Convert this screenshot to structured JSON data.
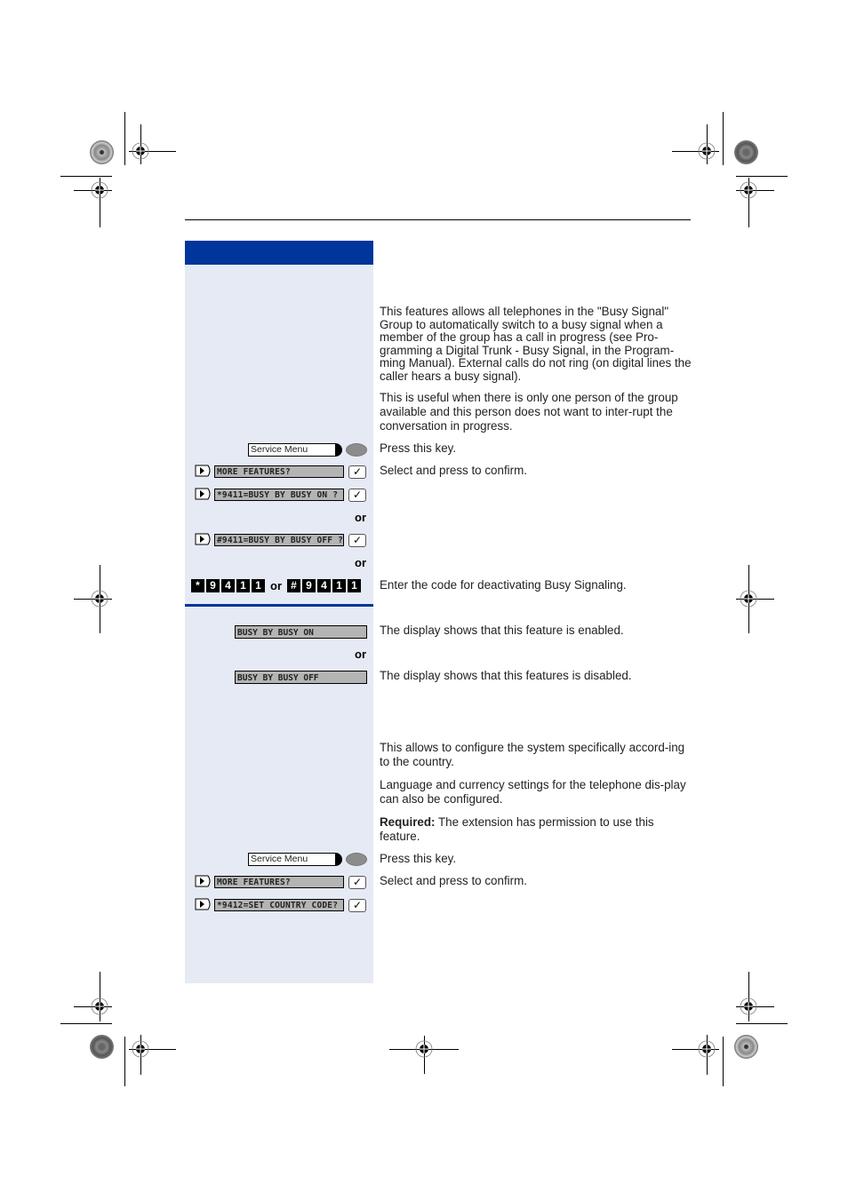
{
  "section1": {
    "intro_paragraphs": [
      "This features allows all telephones in the \"Busy Signal\" Group to automatically switch to a busy signal when a member of the group has a call in progress (see Pro-gramming a Digital Trunk - Busy Signal, in the Program-ming Manual). External calls do not ring (on digital lines the caller hears a busy signal).",
      "This is useful when there is only one person of the group available and this person does not want to inter-rupt the conversation in progress."
    ],
    "service_key_label": "Service Menu",
    "steps": [
      {
        "display": "MORE FEATURES?",
        "description": "Select and press to confirm."
      },
      {
        "display": "*9411=BUSY BY BUSY ON ?"
      },
      {
        "display": "#9411=BUSY BY BUSY OFF ?"
      }
    ],
    "press_key_text": "Press this key.",
    "or_label": "or",
    "code_on": [
      "*",
      "9",
      "4",
      "1",
      "1"
    ],
    "code_off": [
      "#",
      "9",
      "4",
      "1",
      "1"
    ],
    "code_text": "Enter the code for deactivating Busy Signaling.",
    "results": [
      {
        "display": "BUSY BY BUSY ON",
        "description": "The display shows that this feature is enabled."
      },
      {
        "display": "BUSY BY BUSY OFF",
        "description": "The display shows that this features is disabled."
      }
    ]
  },
  "section2": {
    "paragraphs": [
      "This allows to configure the system specifically accord-ing to the country.",
      "Language and currency settings for the telephone dis-play can also be configured."
    ],
    "required_label": "Required:",
    "required_text": " The extension has permission to use this feature.",
    "service_key_label": "Service Menu",
    "press_key_text": "Press this key.",
    "steps": [
      {
        "display": "MORE FEATURES?",
        "description": "Select and press to confirm."
      },
      {
        "display": "*9412=SET COUNTRY CODE?"
      }
    ]
  },
  "icons": {
    "arrow": "right-triangle-key",
    "confirm": "✓"
  }
}
